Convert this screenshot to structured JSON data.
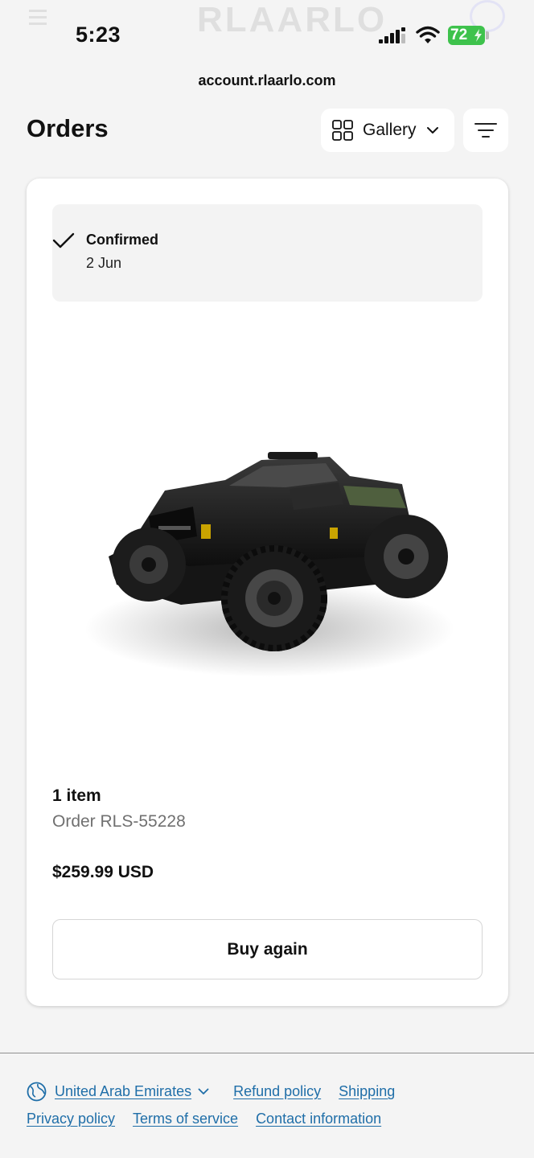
{
  "status_bar": {
    "time": "5:23",
    "battery": "72",
    "background_logo": "RLAARLO"
  },
  "browser": {
    "url": "account.rlaarlo.com"
  },
  "header": {
    "title": "Orders",
    "view_toggle_label": "Gallery"
  },
  "order": {
    "status": "Confirmed",
    "date": "2 Jun",
    "item_count": "1 item",
    "order_number": "Order RLS-55228",
    "total": "$259.99 USD",
    "buy_again_label": "Buy again",
    "product_image": "rc-monster-truck-photo"
  },
  "footer": {
    "country": "United Arab Emirates",
    "links": [
      "Refund policy",
      "Shipping",
      "Privacy policy",
      "Terms of service",
      "Contact information"
    ]
  },
  "colors": {
    "page_bg": "#f4f4f4",
    "link": "#1f6ea8",
    "battery": "#3ec24c"
  }
}
